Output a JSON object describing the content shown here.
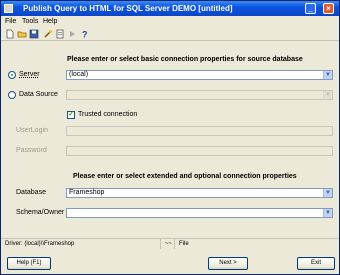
{
  "window": {
    "title": "Publish Query to HTML for SQL Server DEMO [untitled]",
    "minimize": "_",
    "close": "×"
  },
  "menu": [
    "File",
    "Tools",
    "Help"
  ],
  "toolbar": [
    "new-icon",
    "open-icon",
    "save-icon",
    "wizard-icon",
    "properties-icon",
    "run-icon",
    "help-icon"
  ],
  "source_section": {
    "heading": "Please enter or select basic connection properties for source database",
    "server_label": "Server",
    "server_value": "(local)",
    "data_source_label": "Data Source",
    "data_source_value": "",
    "trusted_label": "Trusted connection",
    "userlogin_label": "UserLogin",
    "password_label": "Password"
  },
  "extended_section": {
    "heading": "Please enter or select extended and optional connection properties",
    "database_label": "Database",
    "database_value": "Frameshop",
    "schema_label": "Schema/Owner",
    "schema_value": ""
  },
  "statusbar": {
    "driver": "Driver: (local)\\\\Frameshop",
    "sep": "~~",
    "mode": "File"
  },
  "buttons": {
    "help": "Help (F1)",
    "next": "Next >",
    "exit": "Exit"
  },
  "colors": {
    "titlebar": "#0d54e0",
    "window_bg": "#ece9d8",
    "check_green": "#21a121"
  }
}
